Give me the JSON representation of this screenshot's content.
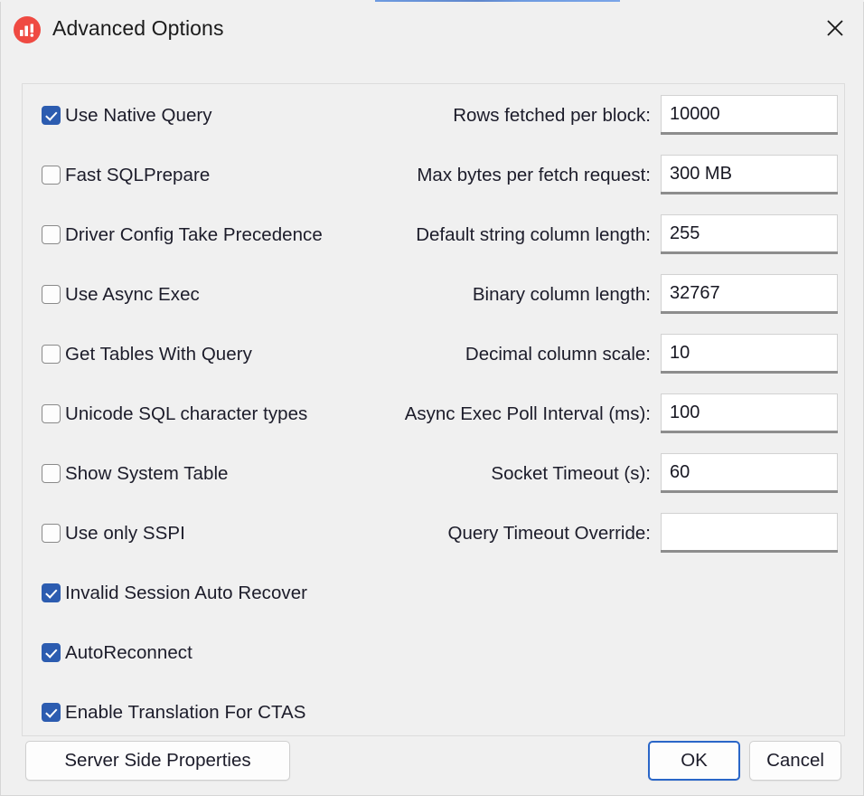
{
  "window": {
    "title": "Advanced Options",
    "app_icon": "bar-chart-alert-icon",
    "close_icon": "close-icon"
  },
  "checkboxes": [
    {
      "label": "Use Native Query",
      "checked": true
    },
    {
      "label": "Fast SQLPrepare",
      "checked": false
    },
    {
      "label": "Driver Config Take Precedence",
      "checked": false
    },
    {
      "label": "Use Async Exec",
      "checked": false
    },
    {
      "label": "Get Tables With Query",
      "checked": false
    },
    {
      "label": "Unicode SQL character types",
      "checked": false
    },
    {
      "label": "Show System Table",
      "checked": false
    },
    {
      "label": "Use only SSPI",
      "checked": false
    },
    {
      "label": "Invalid Session Auto Recover",
      "checked": true
    },
    {
      "label": "AutoReconnect",
      "checked": true
    },
    {
      "label": "Enable Translation For CTAS",
      "checked": true
    }
  ],
  "fields": [
    {
      "label": "Rows fetched per block:",
      "value": "10000"
    },
    {
      "label": "Max bytes per fetch request:",
      "value": "300 MB"
    },
    {
      "label": "Default string column length:",
      "value": "255"
    },
    {
      "label": "Binary column length:",
      "value": "32767"
    },
    {
      "label": "Decimal column scale:",
      "value": "10"
    },
    {
      "label": "Async Exec Poll Interval (ms):",
      "value": "100"
    },
    {
      "label": "Socket Timeout (s):",
      "value": "60"
    },
    {
      "label": "Query Timeout Override:",
      "value": ""
    }
  ],
  "footer": {
    "server_side_properties_label": "Server Side Properties",
    "ok_label": "OK",
    "cancel_label": "Cancel"
  },
  "colors": {
    "checkbox_checked": "#2c5cb0",
    "icon_red": "#ef4a42",
    "focus_blue": "#2a66c8",
    "dialog_background": "#f0f0f0"
  }
}
